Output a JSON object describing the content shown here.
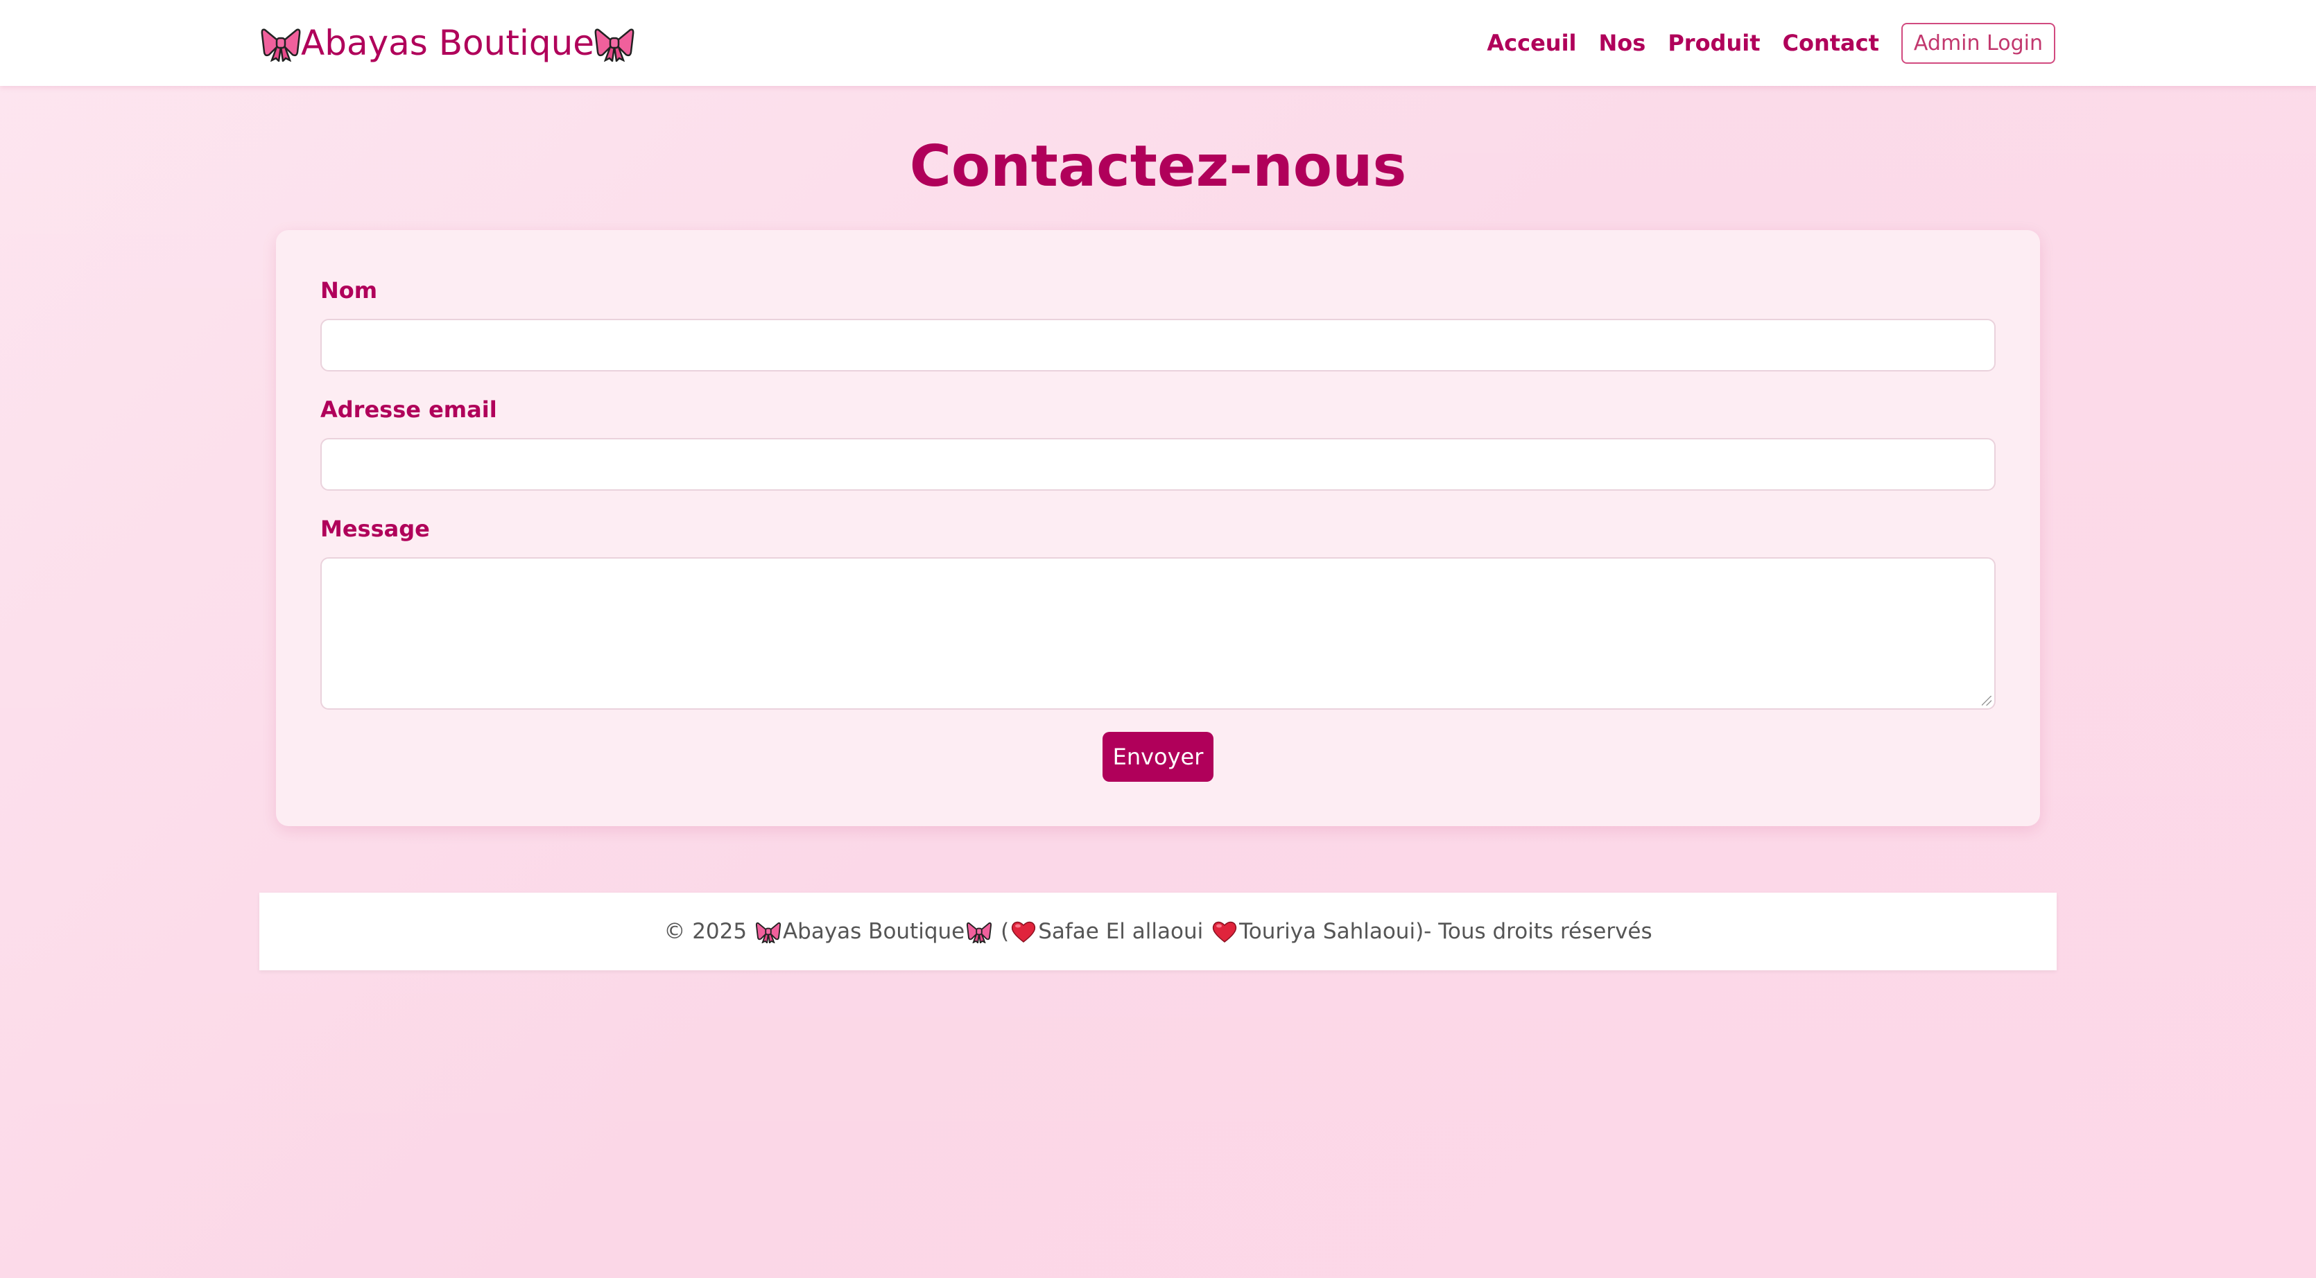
{
  "brand": {
    "name": "Abayas Boutique",
    "icon": "ribbon-bow-icon"
  },
  "nav": {
    "links": [
      "Acceuil",
      "Nos",
      "Produit",
      "Contact"
    ],
    "admin_label": "Admin Login"
  },
  "page": {
    "title": "Contactez-nous"
  },
  "form": {
    "name_label": "Nom",
    "name_value": "",
    "email_label": "Adresse email",
    "email_value": "",
    "message_label": "Message",
    "message_value": "",
    "submit_label": "Envoyer"
  },
  "footer": {
    "copyright_prefix": "© 2025",
    "brand": "Abayas Boutique",
    "open_paren": "(",
    "author1": "Safae El allaoui",
    "author2": "Touriya Sahlaoui)",
    "suffix": "- Tous droits réservés",
    "icons": [
      "ribbon-bow-icon",
      "heart-icon"
    ]
  },
  "colors": {
    "primary": "#b0005a",
    "background": "#fde3ee",
    "card": "#fdedf3",
    "heart": "#e0243c"
  }
}
